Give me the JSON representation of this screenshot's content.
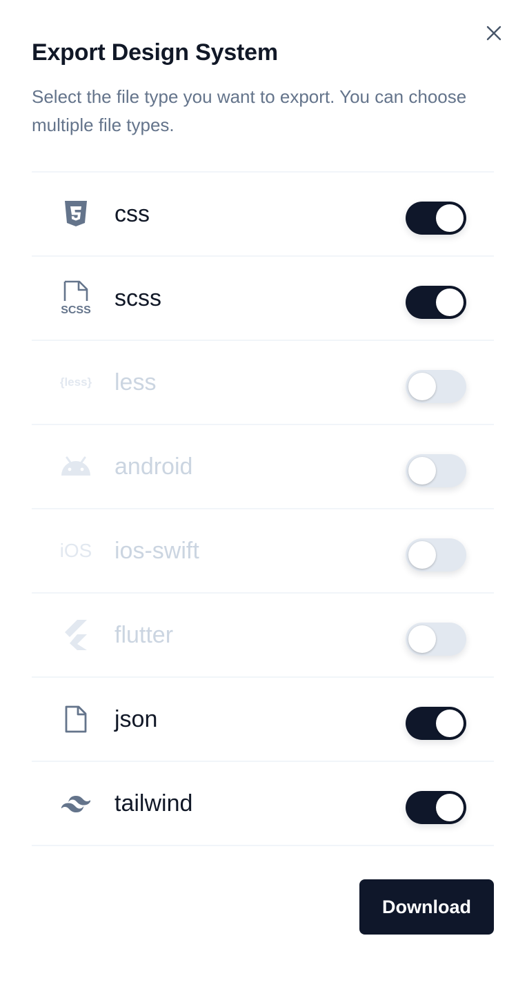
{
  "dialog": {
    "title": "Export Design System",
    "subtitle": "Select the file type you want to export. You can choose multiple file types.",
    "close_icon": "close-icon",
    "download_label": "Download"
  },
  "file_types": [
    {
      "label": "css",
      "icon": "css3-icon",
      "enabled": true
    },
    {
      "label": "scss",
      "icon": "scss-file-icon",
      "enabled": true
    },
    {
      "label": "less",
      "icon": "less-icon",
      "icon_text": "{less}",
      "enabled": false
    },
    {
      "label": "android",
      "icon": "android-icon",
      "enabled": false
    },
    {
      "label": "ios-swift",
      "icon": "ios-icon",
      "icon_text": "iOS",
      "enabled": false
    },
    {
      "label": "flutter",
      "icon": "flutter-icon",
      "enabled": false
    },
    {
      "label": "json",
      "icon": "file-icon",
      "enabled": true
    },
    {
      "label": "tailwind",
      "icon": "tailwind-icon",
      "enabled": true
    }
  ],
  "colors": {
    "primary": "#0f172a",
    "muted_text": "#64748b",
    "disabled_text": "#cbd5e1",
    "toggle_off": "#e2e8f0",
    "divider": "#f1f5f9"
  }
}
